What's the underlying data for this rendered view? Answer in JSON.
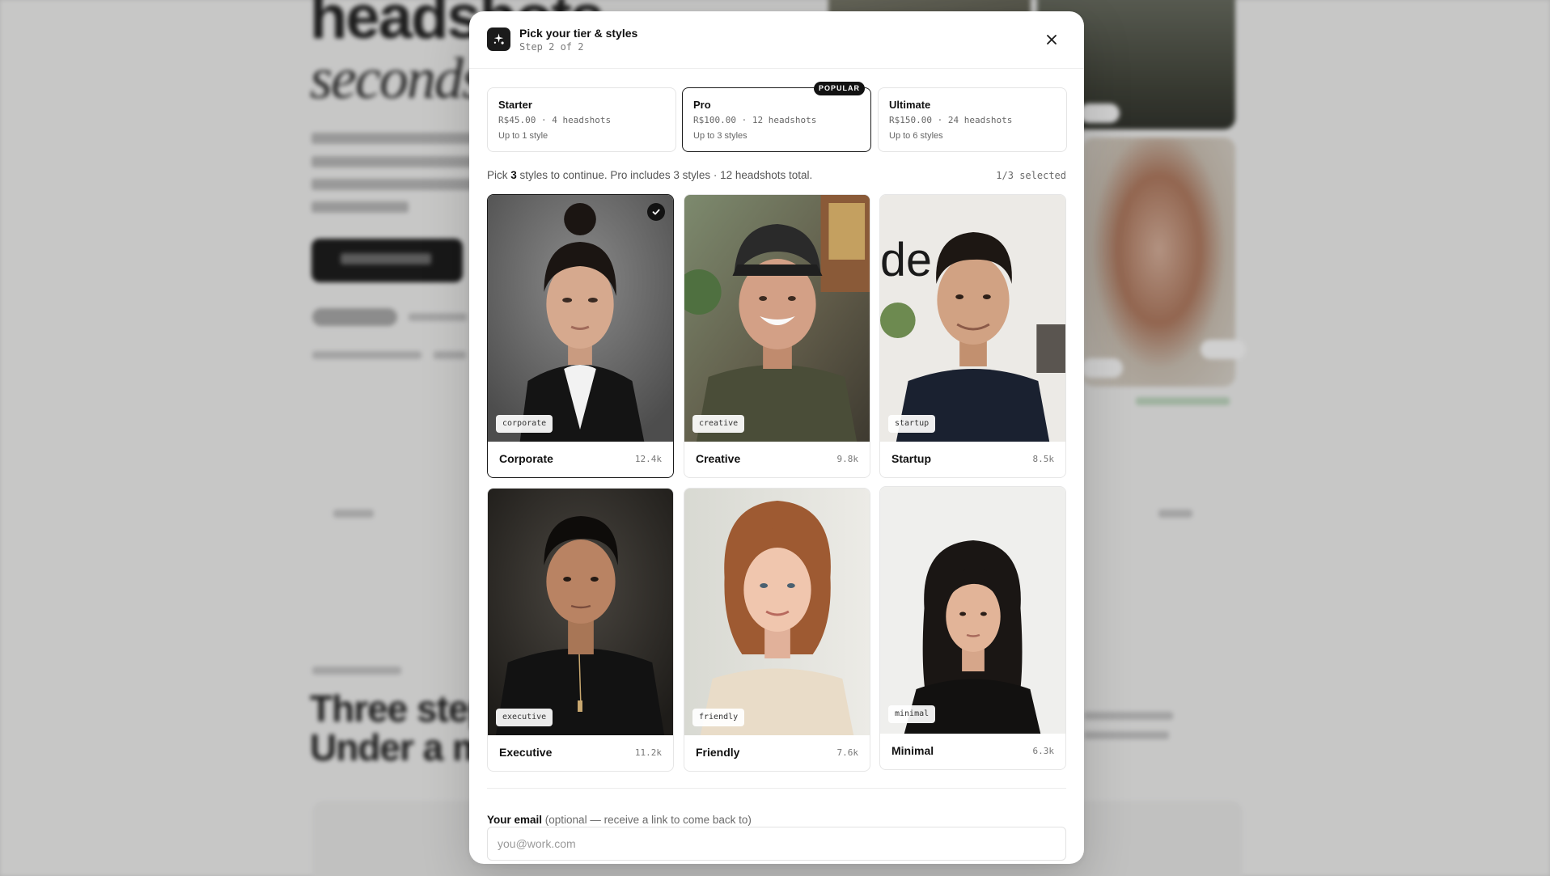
{
  "background": {
    "hero_line1": "headshots",
    "hero_line2": "seconds.",
    "heading_2_line1": "Three step",
    "heading_2_line2": "Under a m"
  },
  "modal": {
    "title": "Pick your tier & styles",
    "step": "Step 2 of 2",
    "close_icon": "close-icon",
    "logo_icon": "sparkle-icon"
  },
  "tiers": [
    {
      "name": "Starter",
      "price": "R$45.00 · 4 headshots",
      "styles": "Up to 1 style",
      "selected": false
    },
    {
      "name": "Pro",
      "price": "R$100.00 · 12 headshots",
      "styles": "Up to 3 styles",
      "selected": true,
      "badge": "POPULAR"
    },
    {
      "name": "Ultimate",
      "price": "R$150.00 · 24 headshots",
      "styles": "Up to 6 styles",
      "selected": false
    }
  ],
  "pick": {
    "prefix": "Pick ",
    "count": "3",
    "suffix": " styles to continue. Pro includes 3 styles · 12 headshots total.",
    "selected_count": "1/3 selected"
  },
  "styles": [
    {
      "tag": "corporate",
      "name": "Corporate",
      "count": "12.4k",
      "selected": true
    },
    {
      "tag": "creative",
      "name": "Creative",
      "count": "9.8k",
      "selected": false
    },
    {
      "tag": "startup",
      "name": "Startup",
      "count": "8.5k",
      "selected": false
    },
    {
      "tag": "executive",
      "name": "Executive",
      "count": "11.2k",
      "selected": false
    },
    {
      "tag": "friendly",
      "name": "Friendly",
      "count": "7.6k",
      "selected": false
    },
    {
      "tag": "minimal",
      "name": "Minimal",
      "count": "6.3k",
      "selected": false
    }
  ],
  "email": {
    "label": "Your email",
    "hint": " (optional — receive a link to come back to)",
    "placeholder": "you@work.com",
    "value": ""
  },
  "colors": {
    "accent": "#121212",
    "border": "#e6e6e6",
    "muted_text": "#666666"
  }
}
